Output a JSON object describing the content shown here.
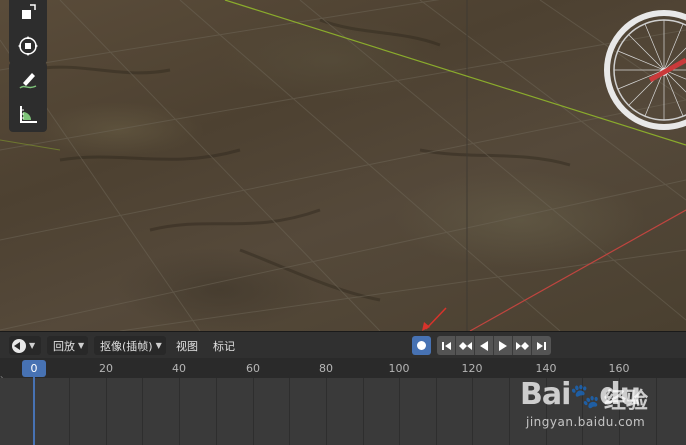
{
  "timeline": {
    "editor_type_icon": "clock-icon",
    "menus": {
      "playback": "回放",
      "keying": "抠像(插帧)",
      "view": "视图",
      "marker": "标记"
    },
    "current_frame": "0",
    "ruler_labels": [
      "20",
      "40",
      "60",
      "80",
      "100",
      "120",
      "140",
      "160"
    ],
    "record_icon": "record-dot-icon",
    "playback_icons": [
      "jump-start-icon",
      "prev-keyframe-icon",
      "play-reverse-icon",
      "play-icon",
      "next-keyframe-icon",
      "jump-end-icon"
    ]
  },
  "toolbar_icons": [
    "scale-icon",
    "transform-icon",
    "annotate-icon",
    "measure-icon"
  ],
  "watermark": {
    "logo": "Bai",
    "logo_suffix": "du",
    "cn": "经验",
    "url": "jingyan.baidu.com"
  },
  "colors": {
    "accent": "#4772b3",
    "x_axis": "#c0453f",
    "y_axis": "#8aab2c"
  }
}
